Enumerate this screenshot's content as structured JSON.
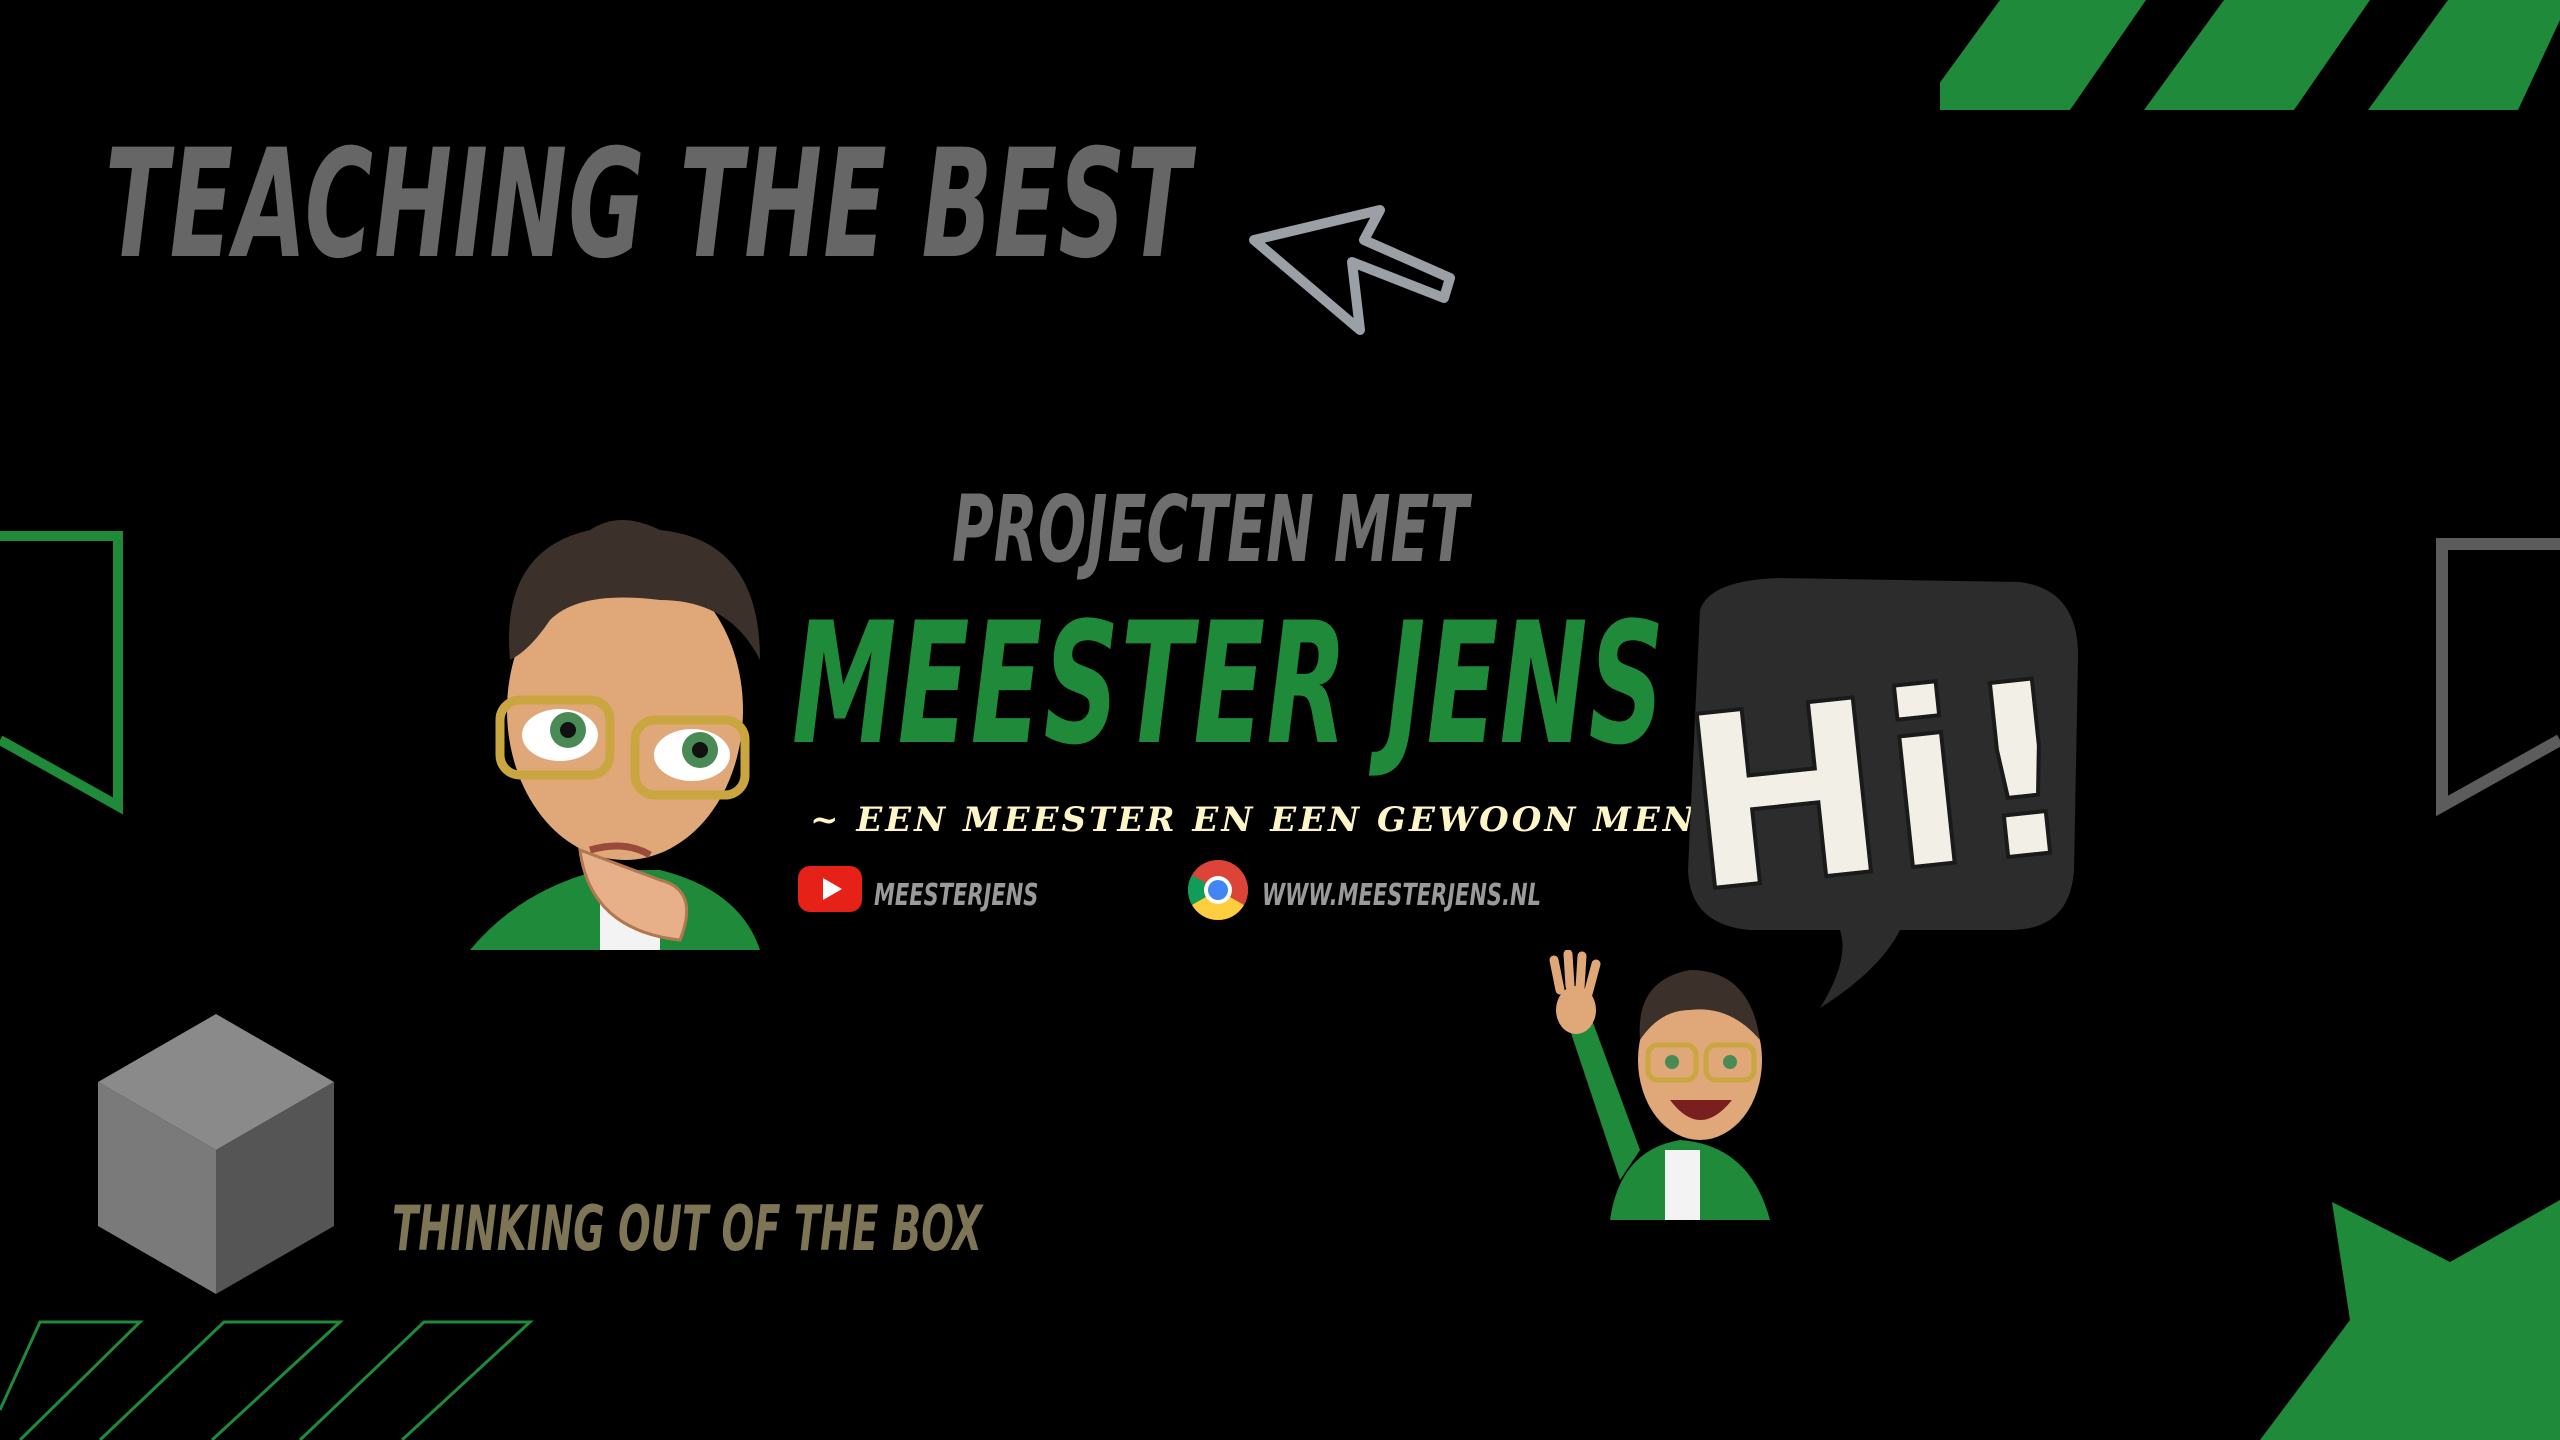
{
  "banner": {
    "tagline_top": "TEACHING THE BEST",
    "title_small": "PROJECTEN MET",
    "title_large": "MEESTER JENS",
    "subtitle": "~ EEN MEESTER EN EEN GEWOON MENS.",
    "youtube_label": "MEESTERJENS",
    "website_label": "WWW.MEESTERJENS.NL",
    "tagline_bottom": "THINKING OUT OF THE BOX",
    "speech_bubble": "Hi!"
  },
  "colors": {
    "background": "#000000",
    "accent_green": "#1e8a3a",
    "gray": "#666666",
    "cream": "#fff6c8",
    "olive": "#7d7555"
  }
}
